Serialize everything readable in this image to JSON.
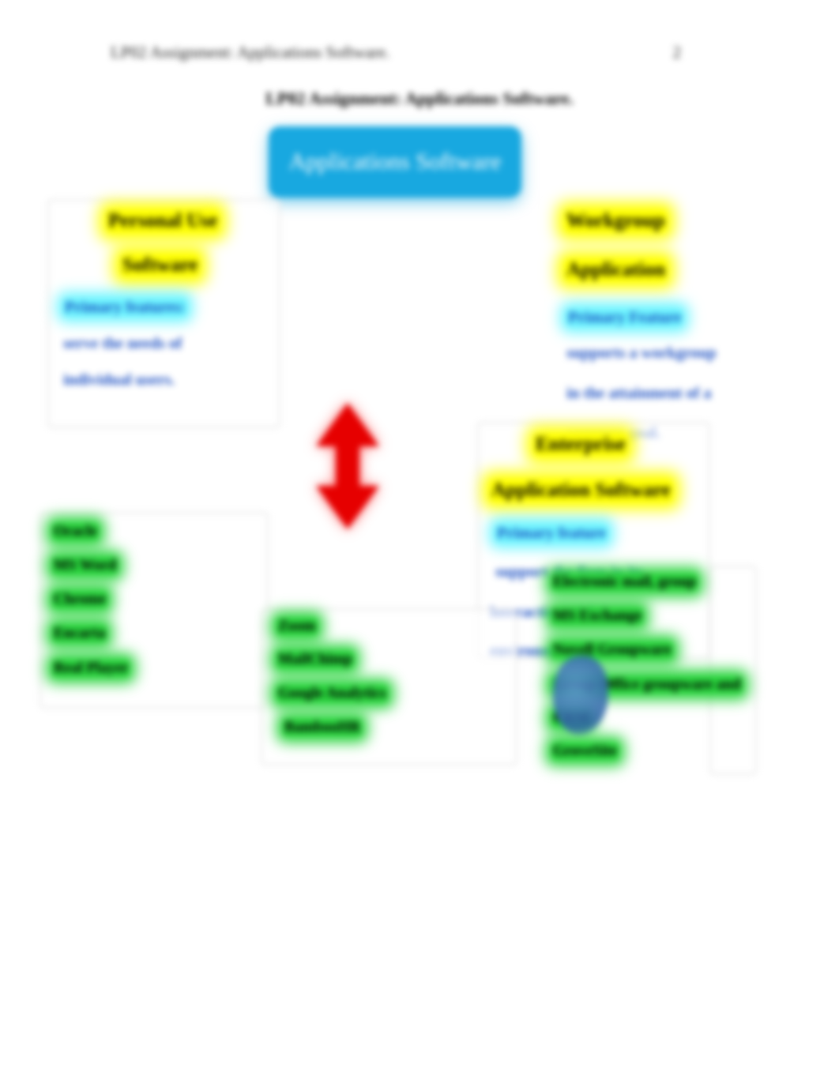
{
  "header": {
    "left": "LP02 Assignment: Applications Software.",
    "page_number": "2"
  },
  "title": "LP02 Assignment: Applications Software.",
  "root": "Applications Software",
  "personal": {
    "heading_line1": "Personal Use",
    "heading_line2": "Software",
    "feature_label": "Primary features:",
    "feature_line1": "serve the needs of",
    "feature_line2": "individual users.",
    "examples": [
      "Oracle",
      "MS Word",
      "Chrome",
      "Encarta",
      "Real Player"
    ]
  },
  "workgroup": {
    "heading_line1": "Workgroup",
    "heading_line2": "Application",
    "feature_label": "Primary Feature",
    "feature_line1": "supports a workgroup",
    "feature_line2": "in the attainment of a",
    "feature_line3": "common goal.",
    "examples": [
      "Electronic mail, group",
      "MS Exchange",
      "Novell Groupware",
      "Group-Office groupware and",
      "CRM",
      "GroveSite"
    ]
  },
  "enterprise": {
    "heading_line1": "Enterprise",
    "heading_line2": "Application Software",
    "feature_label": "Primary feature",
    "feature_line1": "support the firm in its",
    "feature_line2": "interaction with its",
    "feature_line3": "environment.",
    "examples": [
      "Zoom",
      "MailChimp",
      "Google Analytics",
      "BambooHR"
    ]
  }
}
